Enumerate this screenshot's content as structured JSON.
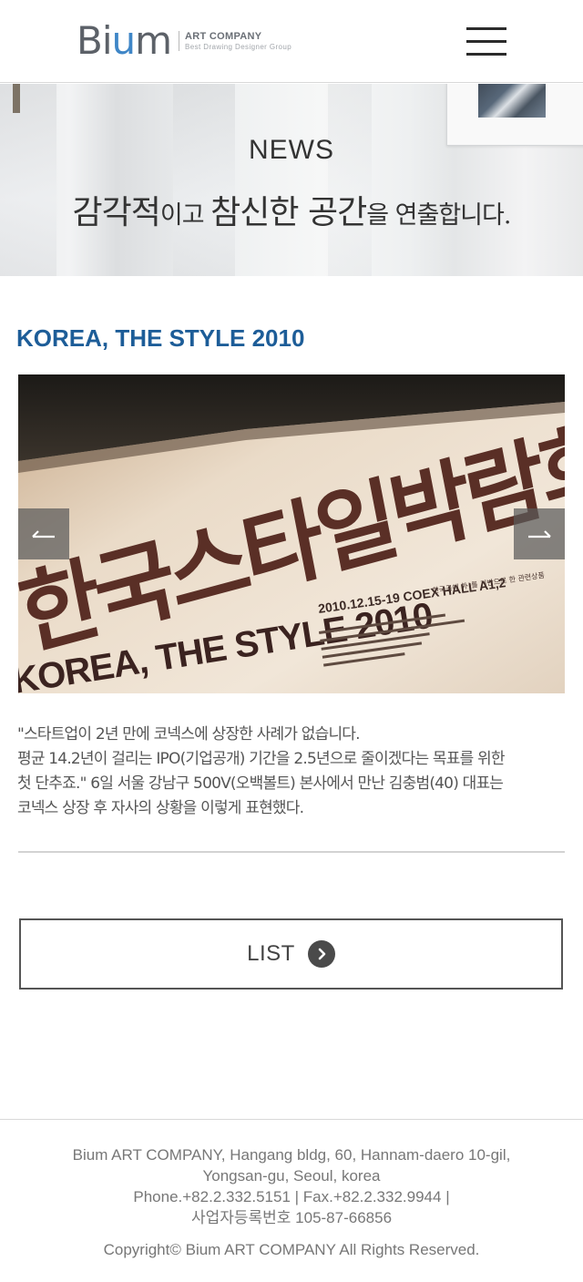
{
  "header": {
    "logo": {
      "word_start": "Bi",
      "word_mid": "u",
      "word_end": "m",
      "name": "ART COMPANY",
      "tagline": "Best Drawing Designer Group"
    }
  },
  "hero": {
    "heading": "NEWS",
    "subtitle_parts": [
      "감각적",
      "이고 ",
      "참신한 공간",
      "을 ",
      "연출합니다."
    ]
  },
  "article": {
    "title": "KOREA, THE STYLE 2010",
    "image": {
      "sign_main": "한국스타일박람회",
      "sign_english": "KOREA, THE STYLE 2010",
      "sign_date_venue": "2010.12.15-19   COEX HALL A1,2",
      "sign_subtitle": "한국공예 外)를 기반으로 한 관련상품"
    },
    "body_lines": [
      "\"스타트업이 2년 만에 코넥스에 상장한 사례가 없습니다.",
      "평균 14.2년이 걸리는 IPO(기업공개) 기간을 2.5년으로 줄이겠다는 목표를 위한",
      "첫 단추죠.\" 6일 서울 강남구 500V(오백볼트) 본사에서 만난 김충범(40) 대표는",
      "코넥스 상장 후 자사의 상황을 이렇게 표현했다."
    ],
    "list_button": "LIST"
  },
  "footer": {
    "address_lines": [
      "Bium ART COMPANY, Hangang bldg, 60, Hannam-daero 10-gil,",
      "Yongsan-gu, Seoul, korea",
      "Phone.+82.2.332.5151 | Fax.+82.2.332.9944 |",
      "사업자등록번호 105-87-66856"
    ],
    "copyright": "Copyright© Bium ART COMPANY All Rights Reserved."
  },
  "colors": {
    "title_blue": "#1d5d98",
    "logo_blue": "#3f86c7",
    "text_gray": "#555555"
  },
  "icons": {
    "menu": "hamburger-icon",
    "prev": "arrow-left-icon",
    "next": "arrow-right-icon",
    "list": "chevron-right-circle-icon"
  }
}
